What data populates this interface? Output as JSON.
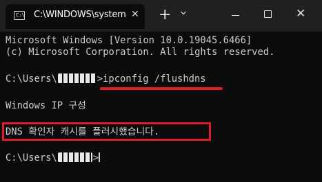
{
  "window": {
    "tab_title": "C:\\WINDOWS\\system",
    "tab_icon_glyph": "C:\\",
    "close_tab_glyph": "✕",
    "new_tab_glyph": "+",
    "dropdown_icon": "chevron-down-icon",
    "minimize_icon": "minimize-icon",
    "maximize_icon": "maximize-icon",
    "close_glyph": "✕"
  },
  "terminal": {
    "line1": "Microsoft Windows [Version 10.0.19045.6466]",
    "line2": "(c) Microsoft Corporation. All rights reserved.",
    "prompt1_prefix": "C:\\Users\\",
    "prompt1_suffix": ">",
    "command": "ipconfig /flushdns",
    "output_header": "Windows IP 구성",
    "output_result": "DNS 확인자 캐시를 플러시했습니다.",
    "prompt2_prefix": "C:\\Users\\",
    "prompt2_suffix": ">"
  },
  "colors": {
    "background": "#0c0c0c",
    "titlebar": "#202020",
    "text": "#cccccc",
    "highlight": "#e21b2c"
  }
}
